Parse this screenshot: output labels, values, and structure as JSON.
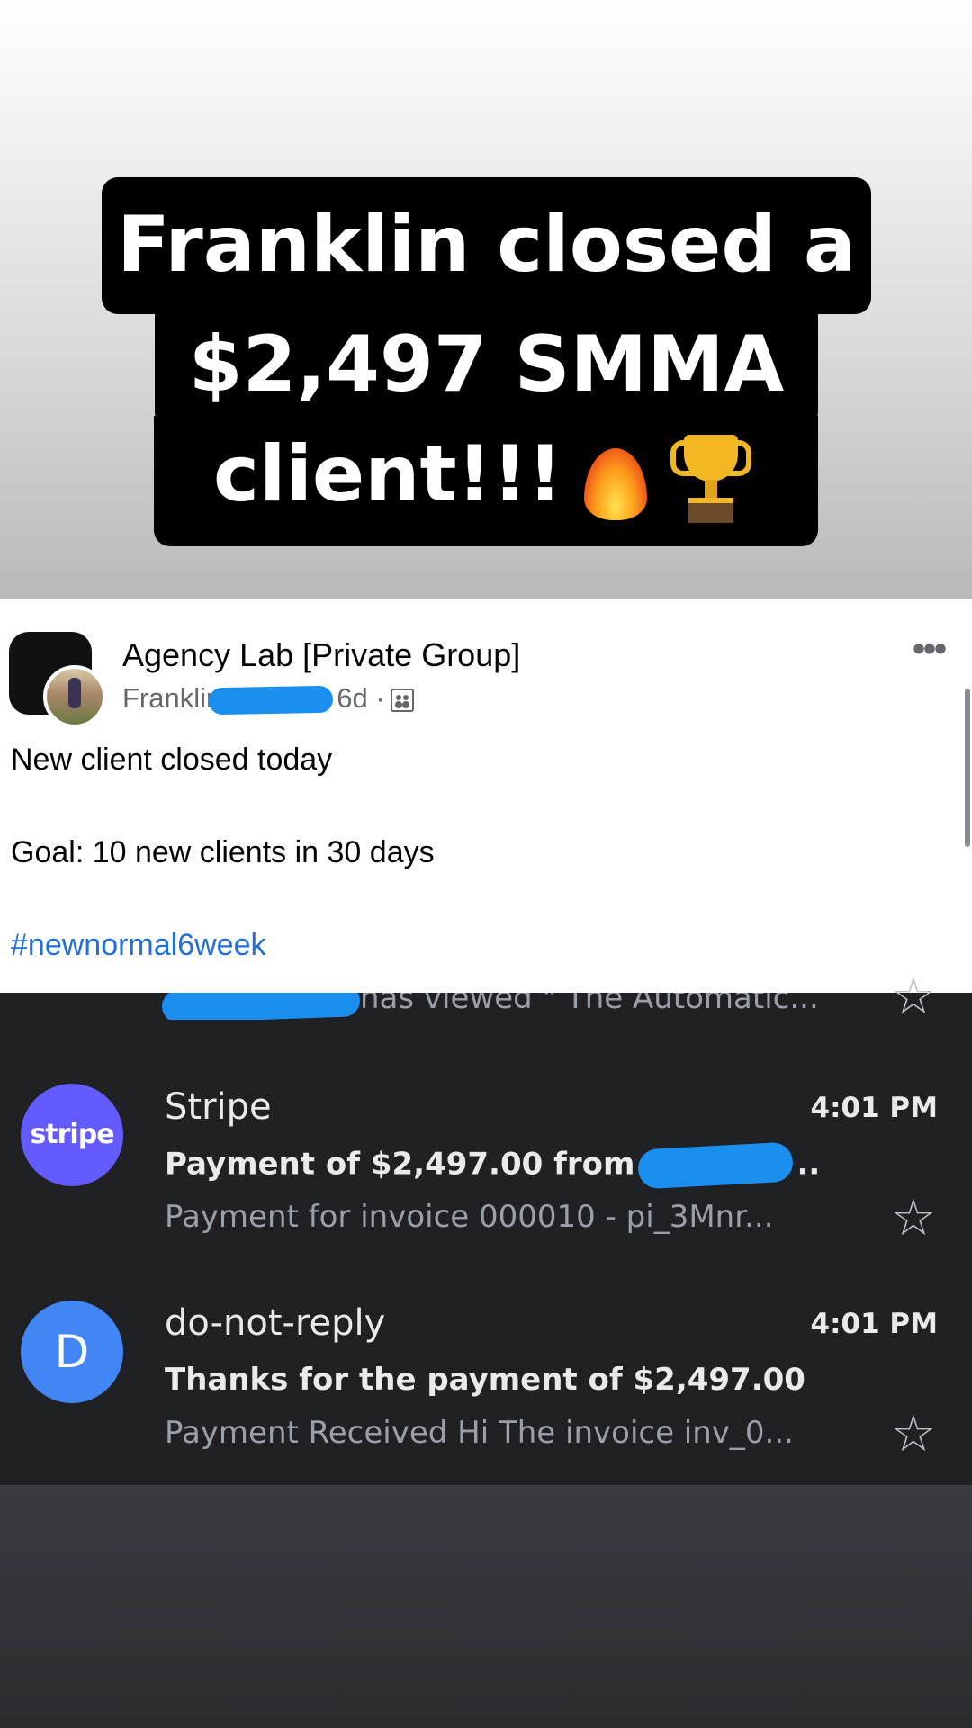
{
  "banner": {
    "line1": "Franklin closed a",
    "line2": "$2,497 SMMA",
    "line3": "client!!!",
    "emoji": [
      "fire-emoji",
      "trophy-emoji"
    ]
  },
  "post": {
    "group_name": "Agency Lab [Private Group]",
    "author": "Franklin",
    "age": "6d ·",
    "more": "•••",
    "line1": "New client closed today",
    "line2": "Goal: 10 new clients in 30 days",
    "hashtag": "#newnormal6week",
    "icons": [
      "group-avatar",
      "user-avatar",
      "privacy-icon",
      "more-icon"
    ]
  },
  "mail": {
    "cut_row_text": "has viewed \" The Automatic...",
    "emails": [
      {
        "avatar": "stripe",
        "sender": "Stripe",
        "time": "4:01 PM",
        "subject_start": "Payment of $2,497.00 from",
        "subject_end": "..",
        "snippet": "Payment for invoice 000010 - pi_3Mnr...",
        "accent": "#635bff"
      },
      {
        "avatar": "D",
        "sender": "do-not-reply",
        "time": "4:01 PM",
        "subject": "Thanks for the payment of $2,497.00",
        "snippet": "Payment Received Hi The invoice inv_0...",
        "accent": "#4285f4"
      }
    ],
    "star": "☆"
  },
  "colors": {
    "redaction": "#1a8ff0",
    "mail_bg": "#202124",
    "hashtag": "#216fdb"
  }
}
